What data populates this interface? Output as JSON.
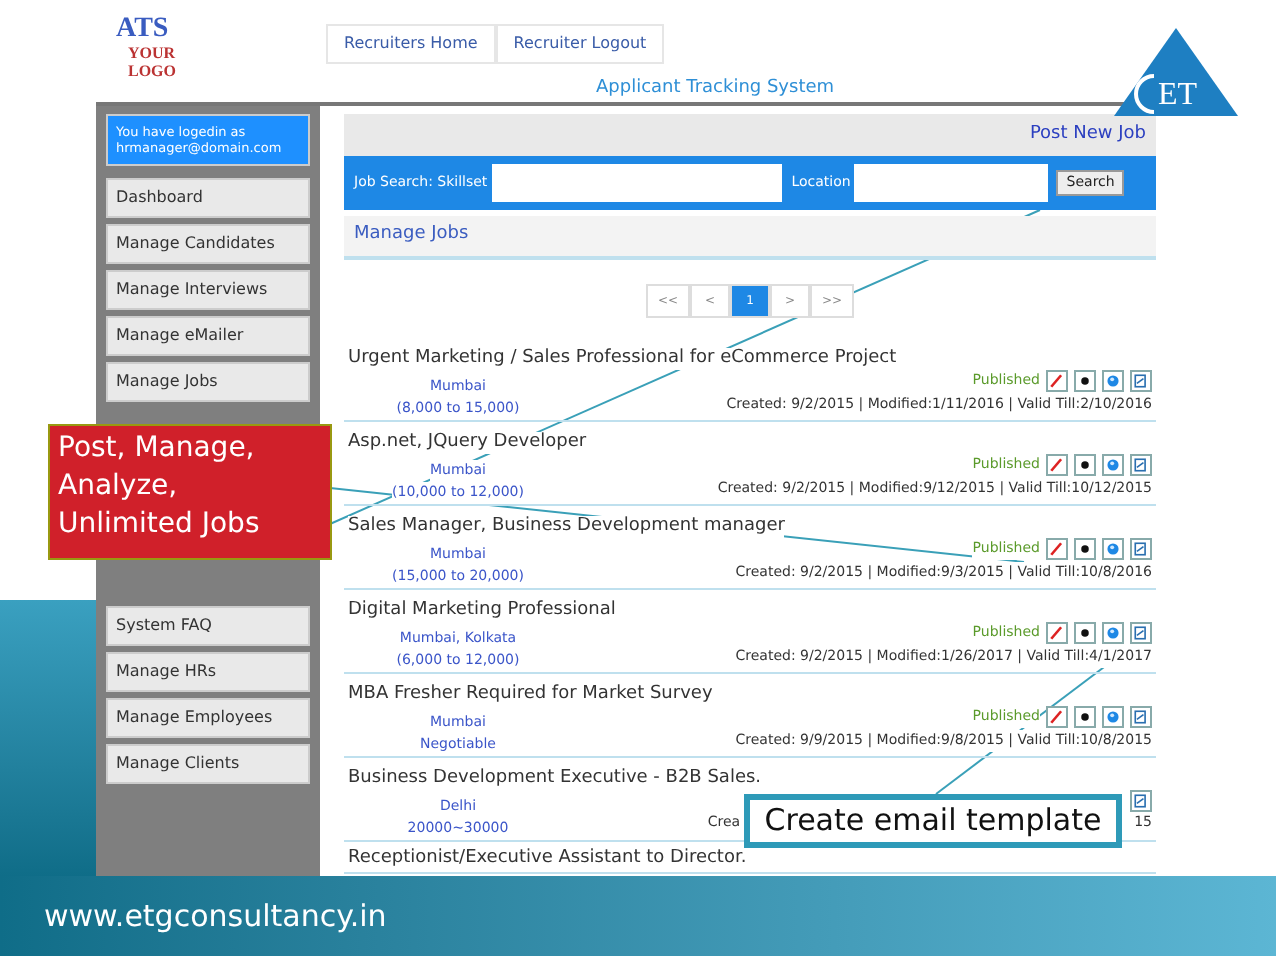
{
  "header": {
    "logo": {
      "top": "ATS",
      "bottom": [
        "YOUR",
        "LOGO"
      ]
    },
    "tabs": [
      {
        "label": "Recruiters Home",
        "selected": false
      },
      {
        "label": "Recruiter Logout",
        "selected": false
      }
    ],
    "title": "Applicant Tracking System",
    "brand_mark": "ET"
  },
  "sidebar": {
    "login_notice": "You have logedin as hrmanager@domain.com",
    "items": [
      {
        "label": "Dashboard"
      },
      {
        "label": "Manage Candidates"
      },
      {
        "label": "Manage Interviews"
      },
      {
        "label": "Manage eMailer"
      },
      {
        "label": "Manage Jobs"
      }
    ],
    "items_lower": [
      {
        "label": "System FAQ"
      },
      {
        "label": "Manage HRs"
      },
      {
        "label": "Manage Employees"
      },
      {
        "label": "Manage Clients"
      }
    ]
  },
  "main": {
    "post_link": "Post New Job",
    "search": {
      "skillset_label": "Job Search: Skillset",
      "location_label": "Location",
      "button": "Search"
    },
    "section_title": "Manage Jobs",
    "pagination": [
      {
        "label": "<<",
        "selected": false
      },
      {
        "label": "<",
        "selected": false
      },
      {
        "label": "1",
        "selected": true
      },
      {
        "label": ">",
        "selected": false
      },
      {
        "label": ">>",
        "selected": false
      }
    ],
    "jobs": [
      {
        "kind": "full",
        "title": "Urgent Marketing / Sales Professional for eCommerce Project",
        "location": "Mumbai",
        "salary": "(8,000 to 15,000)",
        "status": "Published",
        "meta": "Created: 9/2/2015 | Modified:1/11/2016 | Valid Till:2/10/2016"
      },
      {
        "kind": "full",
        "title": "Asp.net, JQuery Developer",
        "location": "Mumbai",
        "salary": "(10,000 to 12,000)",
        "status": "Published",
        "meta": "Created: 9/2/2015 | Modified:9/12/2015 | Valid Till:10/12/2015"
      },
      {
        "kind": "full",
        "title": "Sales Manager, Business Development manager",
        "location": "Mumbai",
        "salary": "(15,000 to 20,000)",
        "status": "Published",
        "meta": "Created: 9/2/2015 | Modified:9/3/2015 | Valid Till:10/8/2016"
      },
      {
        "kind": "full",
        "title": "Digital Marketing Professional",
        "location": "Mumbai, Kolkata",
        "salary": "(6,000 to 12,000)",
        "status": "Published",
        "meta": "Created: 9/2/2015 | Modified:1/26/2017 | Valid Till:4/1/2017"
      },
      {
        "kind": "full",
        "title": "MBA Fresher Required for Market Survey",
        "location": "Mumbai",
        "salary": "Negotiable",
        "status": "Published",
        "meta": "Created: 9/9/2015 | Modified:9/8/2015 | Valid Till:10/8/2015"
      },
      {
        "kind": "covered",
        "title": "Business Development Executive - B2B Sales.",
        "location": "Delhi",
        "salary": "20000~30000",
        "meta_parts": [
          "Crea",
          "15"
        ]
      },
      {
        "kind": "title_only",
        "title": "Receptionist/Executive Assistant to Director."
      }
    ]
  },
  "callouts": [
    {
      "kind": "red",
      "lines": [
        "Post, Manage,",
        "Analyze,",
        "Unlimited Jobs"
      ]
    },
    {
      "kind": "framed",
      "lines": [
        "Create email template"
      ]
    }
  ],
  "footer": {
    "url": "www.etgconsultancy.in"
  }
}
